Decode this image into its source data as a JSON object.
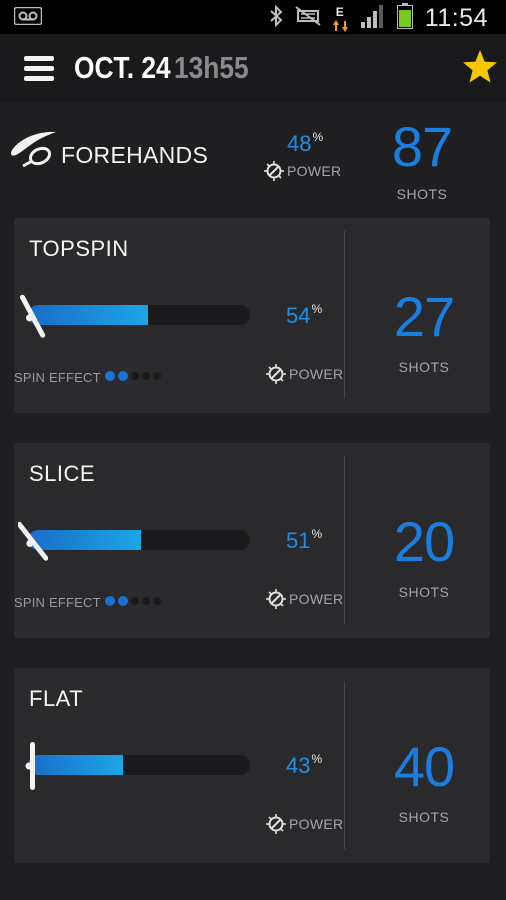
{
  "status_bar": {
    "time": "11:54",
    "network_label": "E",
    "icons": [
      "voicemail-icon",
      "bluetooth-icon",
      "mute-icon",
      "data-icon",
      "signal-icon",
      "battery-icon"
    ]
  },
  "header": {
    "date": "OCT. 24",
    "time": "13h55",
    "menu_icon": "menu-icon",
    "favorite_icon": "star-icon"
  },
  "summary": {
    "title": "FOREHANDS",
    "power_value": "48",
    "percent_sign": "%",
    "power_label": "POWER",
    "shots_count": "87",
    "shots_label": "SHOTS"
  },
  "cards": [
    {
      "title": "TOPSPIN",
      "power_value": "54",
      "percent_sign": "%",
      "power_fraction": 0.54,
      "power_label": "POWER",
      "shots_count": "27",
      "shots_label": "SHOTS",
      "spin_label": "SPIN EFFECT",
      "spin_level": 2,
      "spin_max": 5
    },
    {
      "title": "SLICE",
      "power_value": "51",
      "percent_sign": "%",
      "power_fraction": 0.51,
      "power_label": "POWER",
      "shots_count": "20",
      "shots_label": "SHOTS",
      "spin_label": "SPIN EFFECT",
      "spin_level": 2,
      "spin_max": 5
    },
    {
      "title": "FLAT",
      "power_value": "43",
      "percent_sign": "%",
      "power_fraction": 0.43,
      "power_label": "POWER",
      "shots_count": "40",
      "shots_label": "SHOTS"
    }
  ],
  "colors": {
    "accent": "#1a7ee0",
    "background": "#1f1f21",
    "card": "#2a2a2c",
    "star": "#f7c800",
    "battery": "#7bc91e"
  }
}
